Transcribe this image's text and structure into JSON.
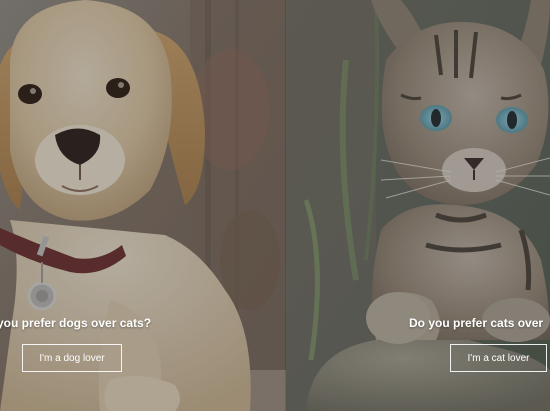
{
  "panels": {
    "dog": {
      "question": "you prefer dogs over cats?",
      "button_label": "I'm a dog lover"
    },
    "cat": {
      "question": "Do you prefer cats over",
      "button_label": "I'm a cat lover"
    }
  },
  "colors": {
    "text": "#ffffff",
    "button_border": "#ffffff"
  }
}
